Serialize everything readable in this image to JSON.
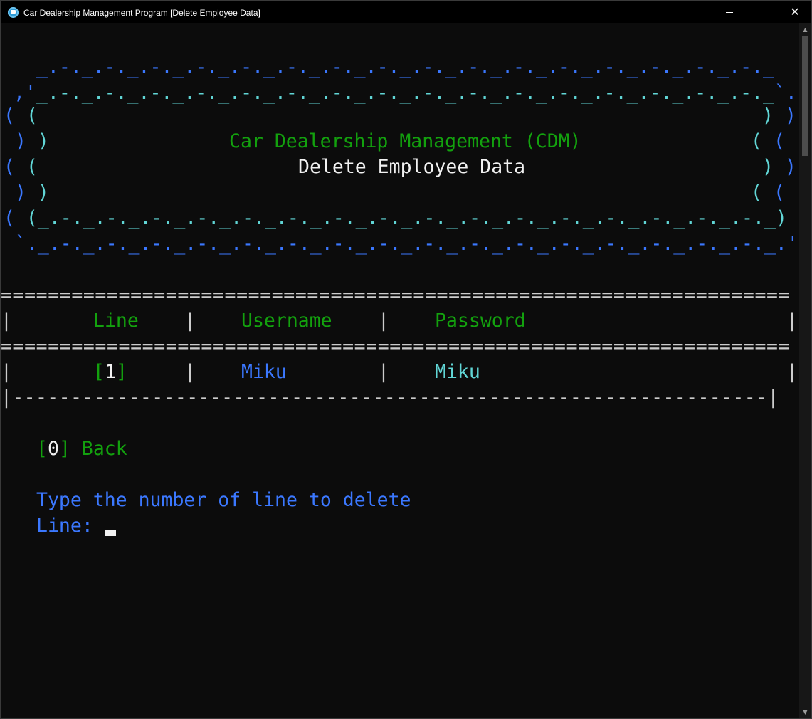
{
  "window": {
    "title": "Car Dealership Management Program [Delete Employee Data]",
    "icon": "app-console-icon",
    "controls": {
      "minimize": "minimize-icon",
      "maximize": "maximize-icon",
      "close": "✕"
    }
  },
  "banner": {
    "row1": " _.-._.-._.-._.-._.-._.-._.-._.-._.-._.-._.-._.-._.-._.-._.-._.-._",
    "row2a": ",'",
    "row2b": "_.-._.-._.-._.-._.-._.-._.-._.-._.-._.-._.-._.-._.-._.-._.-._.-._",
    "row2c": "`.",
    "edge_left_1": "( (",
    "edge_right_1": ") )",
    "edge_left_2": " ) )",
    "edge_right_2": "( (",
    "edge_left_3": "( (",
    "edge_right_3": ") )",
    "edge_left_4": " ) )",
    "edge_right_4": "( (",
    "edge_left_5a": "( ",
    "edge_left_5b": "(",
    "row7": "_.-._.-._.-._.-._.-._.-._.-._.-._.-._.-._.-._.-._.-._.-._.-._.-._",
    "edge_right_5a": ")",
    "edge_right_5b": " )",
    "row8": " `._.-._.-._.-._.-._.-._.-._.-._.-._.-._.-._.-._.-._.-._.-._.-._.-._.'",
    "title": "Car Dealership Management (CDM)",
    "subtitle": "Delete Employee Data"
  },
  "table": {
    "rule_double": "===================================================================",
    "rule_single": "|-----------------------------------------------------------------|",
    "pipe": "|",
    "headers": {
      "line": "Line",
      "username": "Username",
      "password": "Password"
    },
    "rows": [
      {
        "line_open": "[",
        "line_num": "1",
        "line_close": "]",
        "username": "Miku",
        "password": "Miku"
      }
    ]
  },
  "menu": {
    "back_key_open": "[",
    "back_key": "0",
    "back_key_close": "]",
    "back_label": "Back"
  },
  "prompt": {
    "instruction": "Type the number of line to delete",
    "label": "Line:",
    "value": ""
  },
  "colors": {
    "background": "#0c0c0c",
    "green": "#13a10e",
    "blue": "#3b78ff",
    "cyan": "#61d6d6",
    "white": "#f2f2f2"
  }
}
